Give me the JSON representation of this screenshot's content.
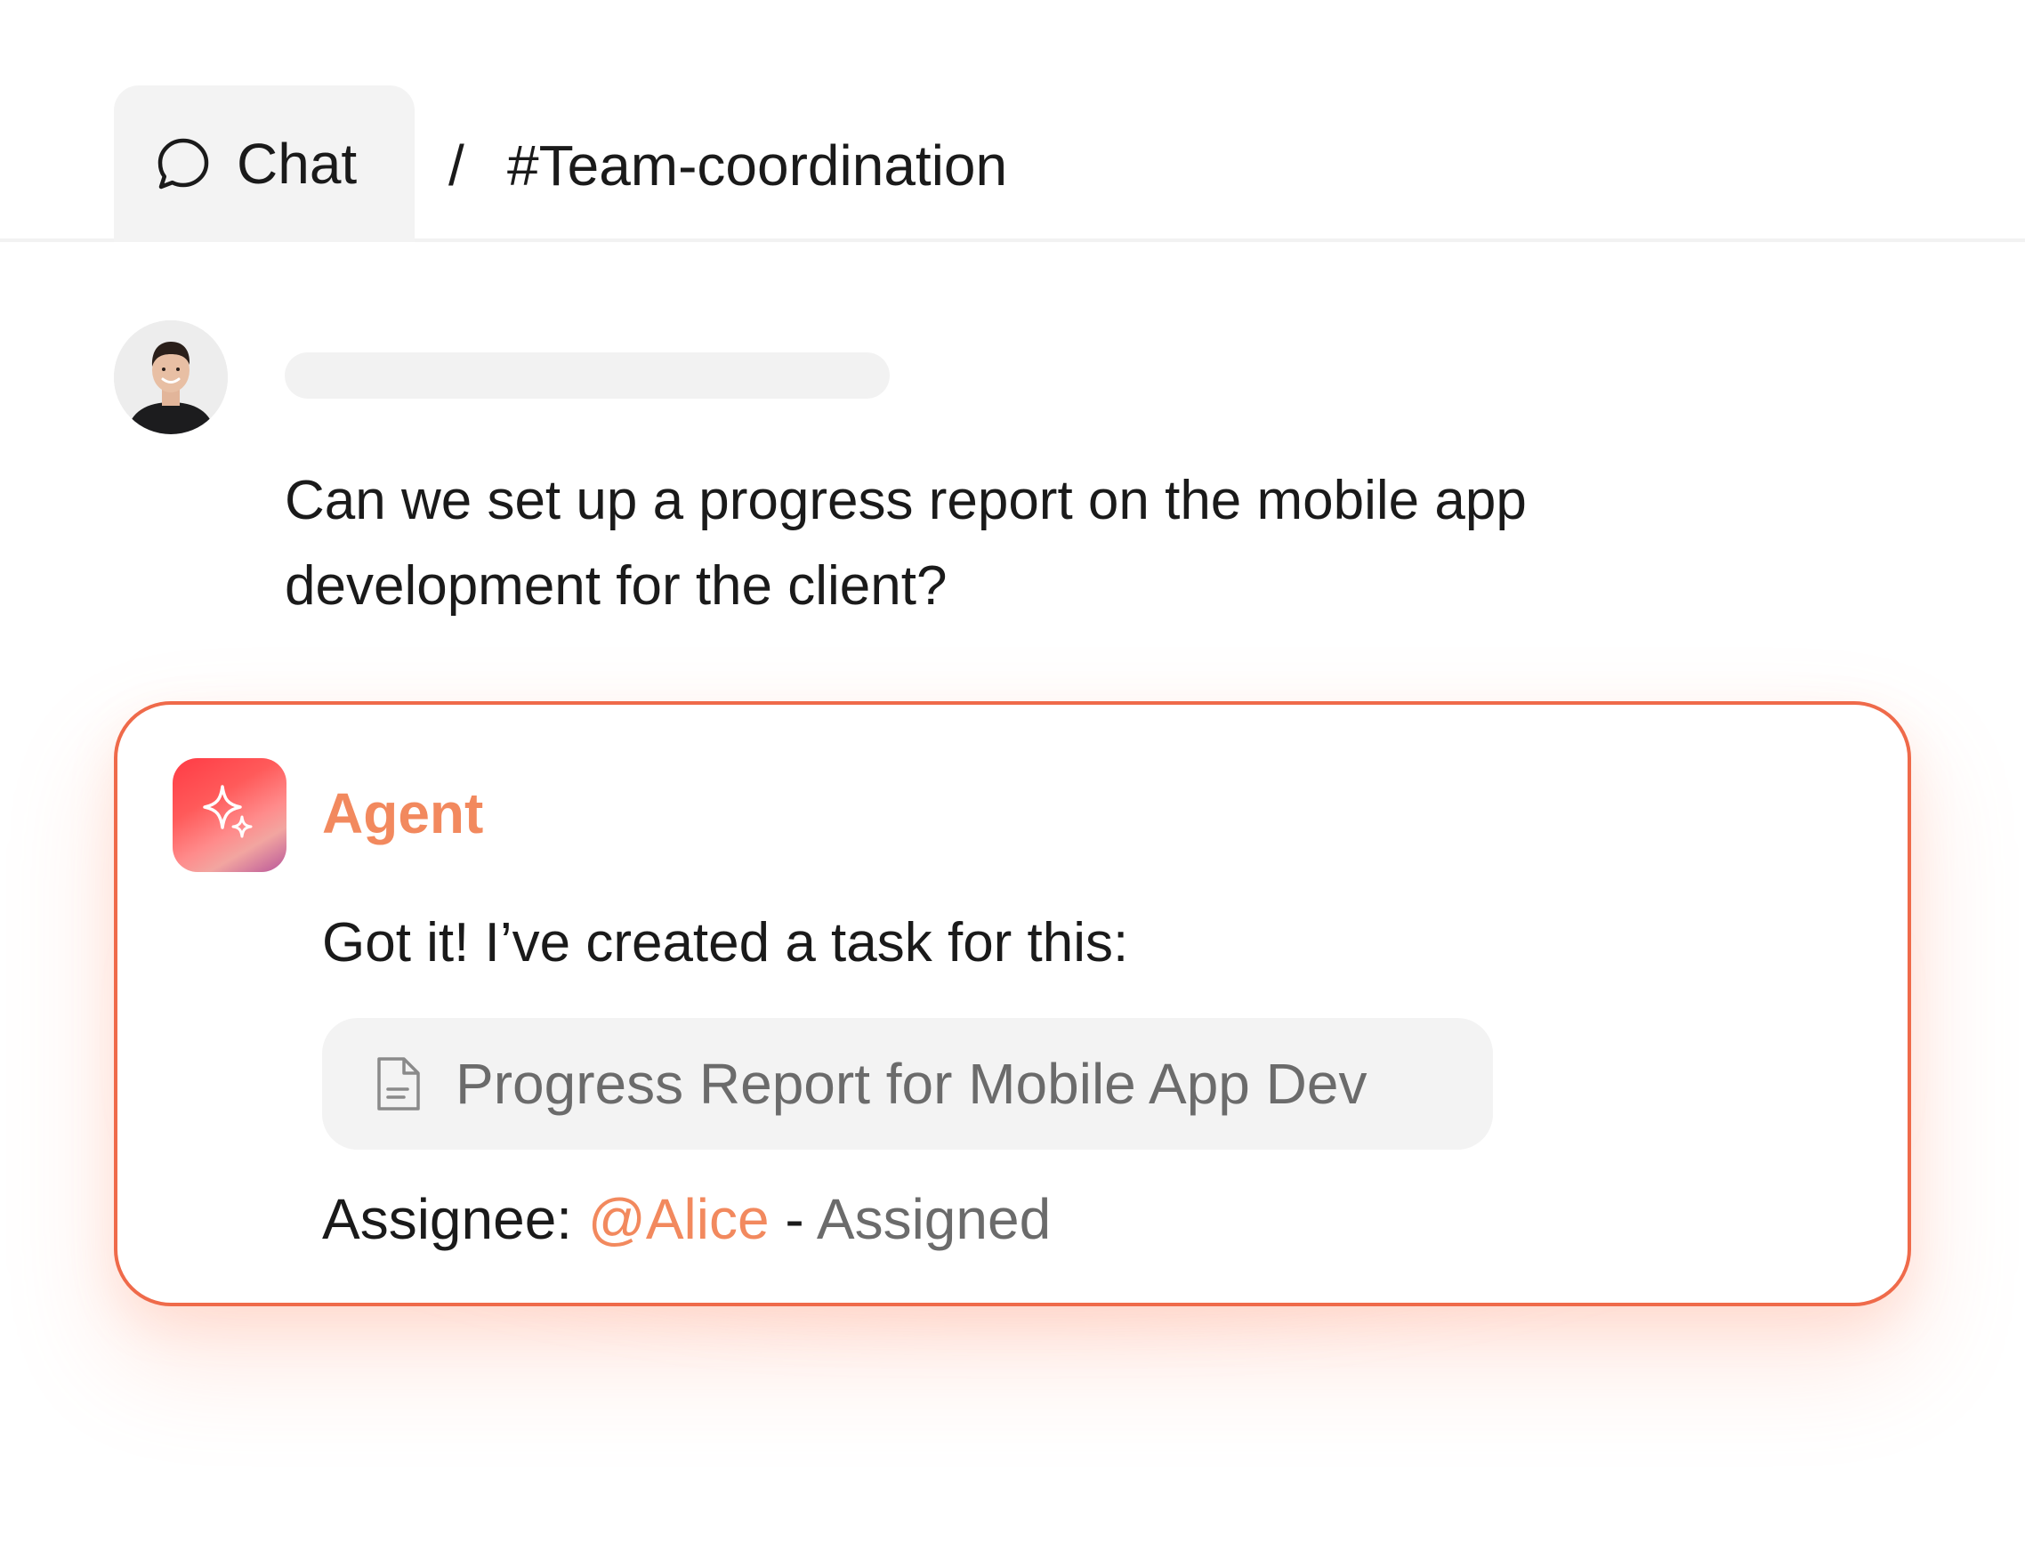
{
  "header": {
    "tab_label": "Chat",
    "separator": "/",
    "channel": "#Team-coordination"
  },
  "message": {
    "line1": "Can we set up a progress report on the mobile app",
    "line2": "development for the client?"
  },
  "agent": {
    "name": "Agent",
    "reply": "Got it! I’ve created a task for this:",
    "task_title": "Progress Report for Mobile App Dev",
    "assignee_label": "Assignee:",
    "assignee_mention": "@Alice",
    "assignee_separator": "-",
    "assignee_status": "Assigned"
  },
  "icons": {
    "tab": "chat-bubble-icon",
    "agent": "sparkles-icon",
    "task": "document-icon"
  },
  "colors": {
    "accent": "#f2895e",
    "card_border": "#ef6a4a",
    "agent_logo_start": "#ff3b45",
    "agent_logo_end": "#b8559a",
    "muted_text": "#6b6b6b"
  }
}
